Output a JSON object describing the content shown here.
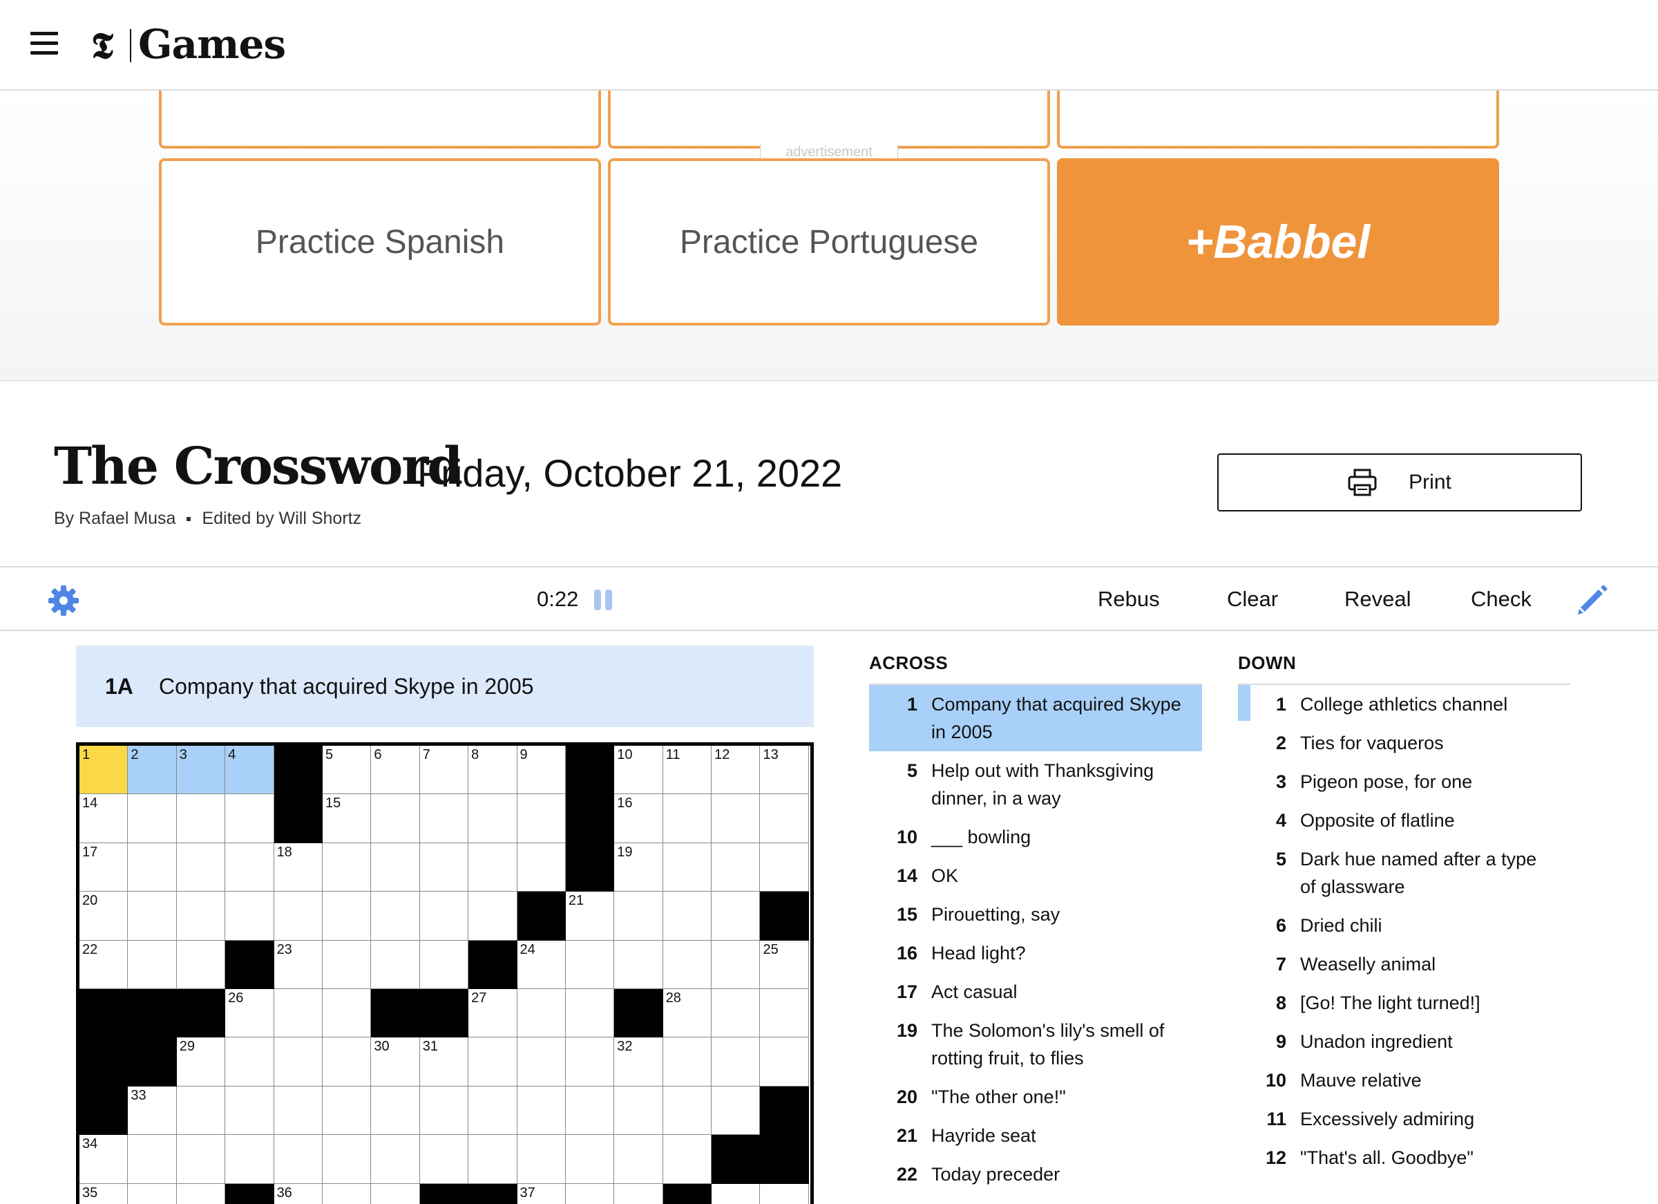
{
  "header": {
    "brand": "Games",
    "logo": "𝕿"
  },
  "ad": {
    "label": "advertisement",
    "tiles": [
      "Practice Spanish",
      "Practice Portuguese"
    ],
    "brand_tile": "+Babbel"
  },
  "puzzle": {
    "title": "The Crossword",
    "date": "Friday, October 21, 2022",
    "author": "By Rafael Musa",
    "editor": "Edited by Will Shortz",
    "print_label": "Print"
  },
  "toolbar": {
    "timer": "0:22",
    "rebus": "Rebus",
    "clear": "Clear",
    "reveal": "Reveal",
    "check": "Check"
  },
  "current_clue": {
    "number": "1A",
    "text": "Company that acquired Skype in 2005"
  },
  "grid": {
    "rows": [
      [
        1,
        2,
        3,
        4,
        "#",
        5,
        6,
        7,
        8,
        9,
        "#",
        10,
        11,
        12,
        13
      ],
      [
        14,
        0,
        0,
        0,
        "#",
        15,
        0,
        0,
        0,
        0,
        "#",
        16,
        0,
        0,
        0
      ],
      [
        17,
        0,
        0,
        0,
        18,
        0,
        0,
        0,
        0,
        0,
        "#",
        19,
        0,
        0,
        0
      ],
      [
        20,
        0,
        0,
        0,
        0,
        0,
        0,
        0,
        0,
        "#",
        21,
        0,
        0,
        0,
        "#"
      ],
      [
        22,
        0,
        0,
        "#",
        23,
        0,
        0,
        0,
        "#",
        24,
        0,
        0,
        0,
        0,
        25
      ],
      [
        "#",
        "#",
        "#",
        26,
        0,
        0,
        "#",
        "#",
        27,
        0,
        0,
        "#",
        28,
        0,
        0
      ],
      [
        "#",
        "#",
        29,
        0,
        0,
        0,
        30,
        31,
        0,
        0,
        0,
        32,
        0,
        0,
        0
      ],
      [
        "#",
        33,
        0,
        0,
        0,
        0,
        0,
        0,
        0,
        0,
        0,
        0,
        0,
        0,
        "#"
      ],
      [
        34,
        0,
        0,
        0,
        0,
        0,
        0,
        0,
        0,
        0,
        0,
        0,
        0,
        "#",
        "#"
      ],
      [
        35,
        0,
        0,
        "#",
        36,
        0,
        0,
        "#",
        "#",
        37,
        0,
        0,
        "#",
        0,
        0
      ]
    ]
  },
  "across": {
    "heading": "ACROSS",
    "clues": [
      {
        "n": "1",
        "t": "Company that acquired Skype in 2005"
      },
      {
        "n": "5",
        "t": "Help out with Thanksgiving dinner, in a way"
      },
      {
        "n": "10",
        "t": "___ bowling"
      },
      {
        "n": "14",
        "t": "OK"
      },
      {
        "n": "15",
        "t": "Pirouetting, say"
      },
      {
        "n": "16",
        "t": "Head light?"
      },
      {
        "n": "17",
        "t": "Act casual"
      },
      {
        "n": "19",
        "t": "The Solomon's lily's smell of rotting fruit, to flies"
      },
      {
        "n": "20",
        "t": "\"The other one!\""
      },
      {
        "n": "21",
        "t": "Hayride seat"
      },
      {
        "n": "22",
        "t": "Today preceder"
      }
    ]
  },
  "down": {
    "heading": "DOWN",
    "clues": [
      {
        "n": "1",
        "t": "College athletics channel"
      },
      {
        "n": "2",
        "t": "Ties for vaqueros"
      },
      {
        "n": "3",
        "t": "Pigeon pose, for one"
      },
      {
        "n": "4",
        "t": "Opposite of flatline"
      },
      {
        "n": "5",
        "t": "Dark hue named after a type of glassware"
      },
      {
        "n": "6",
        "t": "Dried chili"
      },
      {
        "n": "7",
        "t": "Weaselly animal"
      },
      {
        "n": "8",
        "t": "[Go! The light turned!]"
      },
      {
        "n": "9",
        "t": "Unadon ingredient"
      },
      {
        "n": "10",
        "t": "Mauve relative"
      },
      {
        "n": "11",
        "t": "Excessively admiring"
      },
      {
        "n": "12",
        "t": "\"That's all. Goodbye\""
      }
    ]
  },
  "colors": {
    "highlight": "#a8d0f8",
    "selected": "#fbd845",
    "ad_orange": "#f0943c",
    "accent": "#4f85e5"
  }
}
